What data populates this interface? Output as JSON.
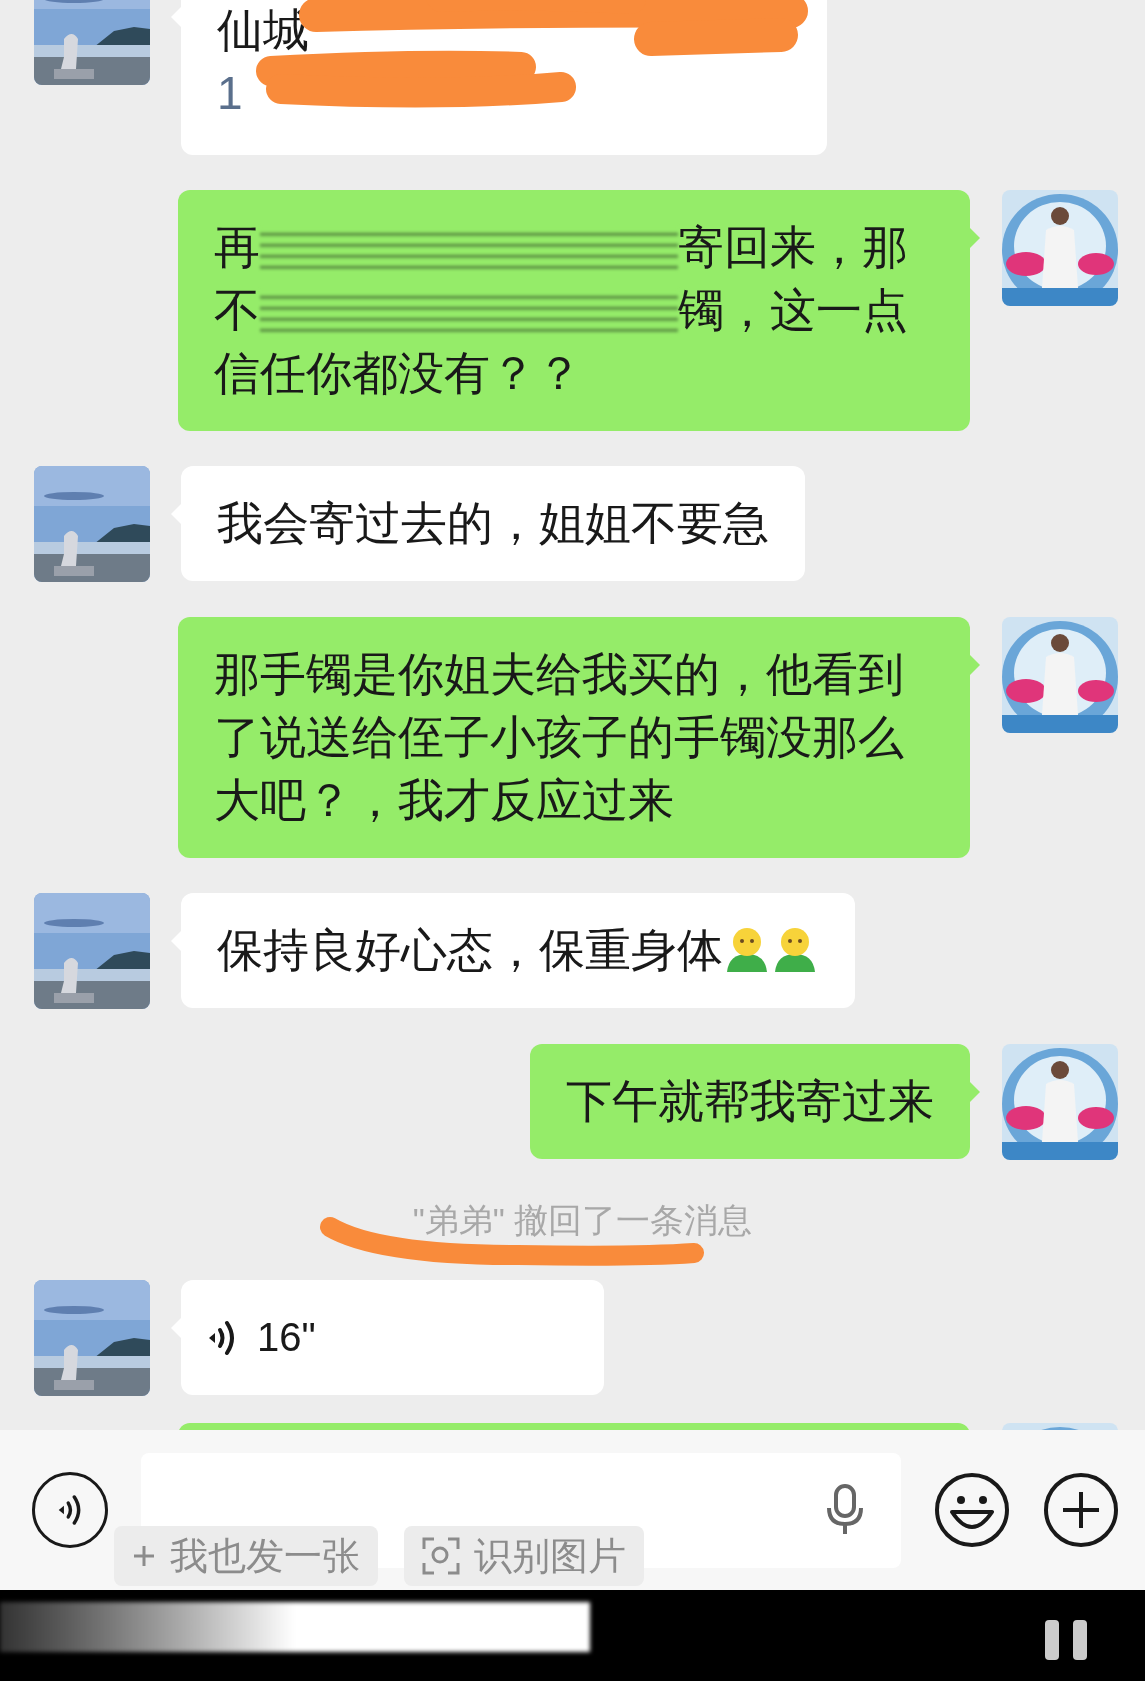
{
  "messages": [
    {
      "outgoing": false,
      "kind": "scribbled",
      "lines": [
        "仙城",
        "1"
      ]
    },
    {
      "outgoing": true,
      "kind": "blurred",
      "lines": [
        [
          "再",
          "寄回来，那"
        ],
        [
          "不",
          "镯，这一点"
        ],
        [
          "信任你都没有？？"
        ]
      ]
    },
    {
      "outgoing": false,
      "kind": "text",
      "text": "我会寄过去的，姐姐不要急"
    },
    {
      "outgoing": true,
      "kind": "text",
      "text": "那手镯是你姐夫给我买的，他看到了说送给侄子小孩子的手镯没那么大吧？，我才反应过来"
    },
    {
      "outgoing": false,
      "kind": "text",
      "text": "保持良好心态，保重身体",
      "emojis": [
        {
          "kind": "person"
        },
        {
          "kind": "person"
        }
      ]
    },
    {
      "outgoing": true,
      "kind": "text",
      "text": "下午就帮我寄过来"
    },
    {
      "kind": "system",
      "text": "\"弟弟\" 撤回了一条消息",
      "scribbled": true
    },
    {
      "outgoing": false,
      "kind": "voice",
      "duration": "16\""
    },
    {
      "outgoing": true,
      "kind": "cut"
    }
  ],
  "input_bar": {
    "chips": [
      {
        "kind": "plus",
        "label": "我也发一张"
      },
      {
        "kind": "scan",
        "label": "识别图片"
      }
    ]
  }
}
